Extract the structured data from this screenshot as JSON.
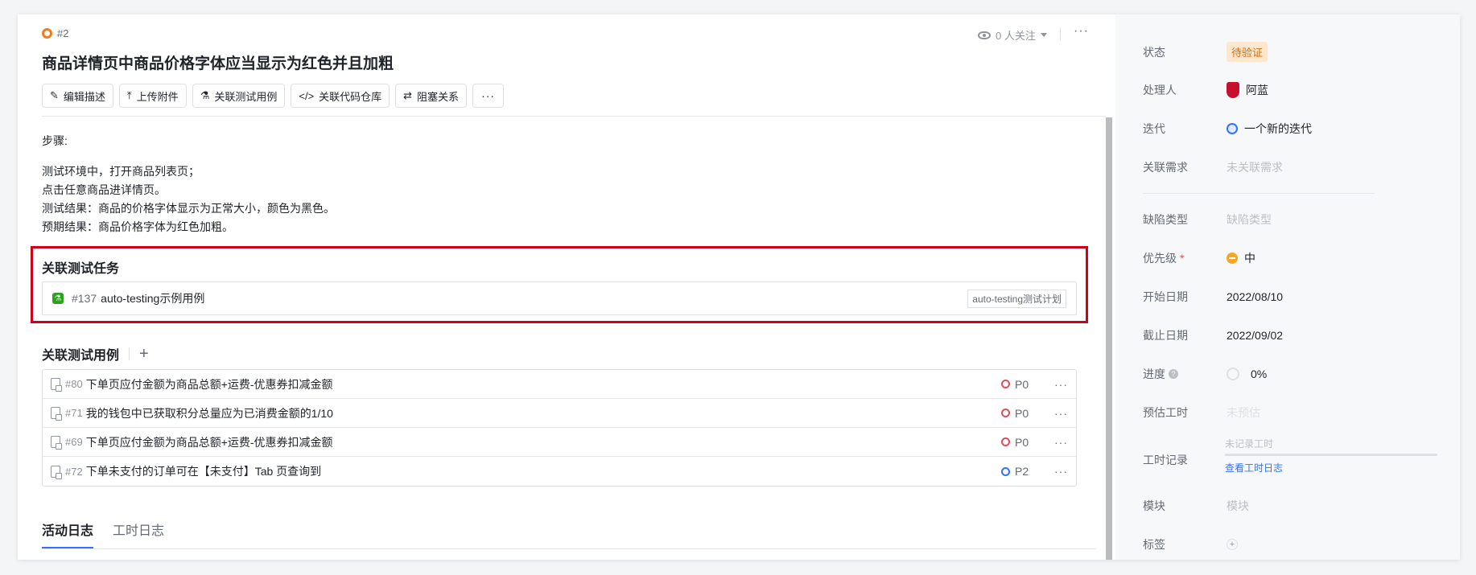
{
  "header": {
    "bug_id": "#2",
    "title": "商品详情页中商品价格字体应当显示为红色并且加粗",
    "followers": "0 人关注",
    "more": "···"
  },
  "toolbar": [
    {
      "icon": "edit-icon",
      "label": "编辑描述"
    },
    {
      "icon": "upload-icon",
      "label": "上传附件"
    },
    {
      "icon": "flask-icon",
      "label": "关联测试用例"
    },
    {
      "icon": "code-icon",
      "label": "关联代码仓库"
    },
    {
      "icon": "block-icon",
      "label": "阻塞关系"
    },
    {
      "icon": "more-icon",
      "label": "···"
    }
  ],
  "description": {
    "step_label": "步骤:",
    "lines": [
      "测试环境中，打开商品列表页；",
      "点击任意商品进详情页。",
      "测试结果：商品的价格字体显示为正常大小，颜色为黑色。",
      "预期结果：商品价格字体为红色加粗。"
    ]
  },
  "linked_tasks": {
    "title": "关联测试任务",
    "task": {
      "id": "#137",
      "name": "auto-testing示例用例",
      "plan": "auto-testing测试计划"
    }
  },
  "linked_cases": {
    "title": "关联测试用例",
    "add": "+",
    "rows": [
      {
        "id": "#80",
        "name": "下单页应付金额为商品总额+运费-优惠券扣减金额",
        "priority": "P0",
        "priority_color": "#e34d59"
      },
      {
        "id": "#71",
        "name": "我的钱包中已获取积分总量应为已消费金额的1/10",
        "priority": "P0",
        "priority_color": "#e34d59"
      },
      {
        "id": "#69",
        "name": "下单页应付金额为商品总额+运费-优惠券扣减金额",
        "priority": "P0",
        "priority_color": "#e34d59"
      },
      {
        "id": "#72",
        "name": "下单未支付的订单可在【未支付】Tab 页查询到",
        "priority": "P2",
        "priority_color": "#3370ff"
      }
    ]
  },
  "tabs": [
    {
      "label": "活动日志",
      "active": true
    },
    {
      "label": "工时日志",
      "active": false
    }
  ],
  "side": {
    "status_label": "状态",
    "status_value": "待验证",
    "assignee_label": "处理人",
    "assignee_value": "阿蓝",
    "iteration_label": "迭代",
    "iteration_value": "一个新的迭代",
    "requirement_label": "关联需求",
    "requirement_value": "未关联需求",
    "defect_type_label": "缺陷类型",
    "defect_type_value": "缺陷类型",
    "priority_label": "优先级",
    "priority_required": "*",
    "priority_value": "中",
    "start_label": "开始日期",
    "start_value": "2022/08/10",
    "end_label": "截止日期",
    "end_value": "2022/09/02",
    "progress_label": "进度",
    "progress_value": "0%",
    "estimate_label": "预估工时",
    "estimate_value": "未预估",
    "worklog_label": "工时记录",
    "worklog_placeholder": "未记录工时",
    "worklog_link": "查看工时日志",
    "module_label": "模块",
    "module_value": "模块",
    "tags_label": "标签",
    "tags_add": "+"
  },
  "colors": {
    "accent": "#3370ff",
    "highlight_border": "#d0021b",
    "status_bg": "#fde8cf",
    "status_text": "#d86b0b"
  }
}
